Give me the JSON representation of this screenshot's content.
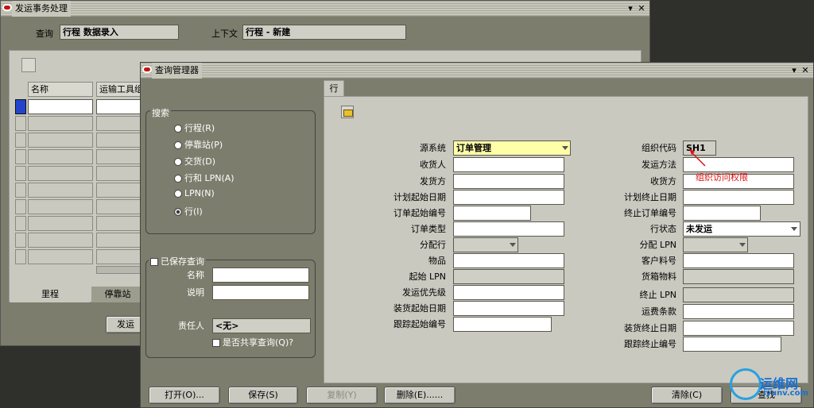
{
  "bg_window": {
    "title": "发运事务处理",
    "query_label": "查询",
    "query_value": "行程 数据录入",
    "context_label": "上下文",
    "context_value": "行程 - 新建",
    "col_name": "名称",
    "col_vehicle": "运输工具组",
    "tab_milestone": "里程",
    "tab_stop": "停靠站",
    "ship_button": "发运"
  },
  "query_manager": {
    "title": "查询管理器",
    "search": {
      "legend": "搜索",
      "options": [
        {
          "label": "行程(R)",
          "selected": false
        },
        {
          "label": "停靠站(P)",
          "selected": false
        },
        {
          "label": "交货(D)",
          "selected": false
        },
        {
          "label": "行和 LPN(A)",
          "selected": false
        },
        {
          "label": "LPN(N)",
          "selected": false
        },
        {
          "label": "行(I)",
          "selected": true
        }
      ]
    },
    "saved": {
      "legend": "已保存查询",
      "name_label": "名称",
      "desc_label": "说明",
      "owner_label": "责任人",
      "owner_value": "<无>",
      "shared_label": "是否共享查询(Q)?"
    },
    "tab_label": "行",
    "left_fields": [
      {
        "label": "源系统",
        "value": "订单管理"
      },
      {
        "label": "收货人",
        "value": ""
      },
      {
        "label": "发货方",
        "value": ""
      },
      {
        "label": "计划起始日期",
        "value": ""
      },
      {
        "label": "订单起始编号",
        "value": ""
      },
      {
        "label": "订单类型",
        "value": ""
      },
      {
        "label": "分配行",
        "value": ""
      },
      {
        "label": "物品",
        "value": ""
      },
      {
        "label": "起始 LPN",
        "value": ""
      },
      {
        "label": "发运优先级",
        "value": ""
      },
      {
        "label": "装货起始日期",
        "value": ""
      },
      {
        "label": "跟踪起始编号",
        "value": ""
      }
    ],
    "right_fields": [
      {
        "label": "组织代码",
        "value": "SH1"
      },
      {
        "label": "发运方法",
        "value": ""
      },
      {
        "label": "收货方",
        "value": ""
      },
      {
        "label": "计划终止日期",
        "value": ""
      },
      {
        "label": "终止订单编号",
        "value": ""
      },
      {
        "label": "行状态",
        "value": "未发运"
      },
      {
        "label": "分配 LPN",
        "value": ""
      },
      {
        "label": "客户料号",
        "value": ""
      },
      {
        "label": "货箱物料",
        "value": ""
      },
      {
        "label": "终止 LPN",
        "value": ""
      },
      {
        "label": "运费条款",
        "value": ""
      },
      {
        "label": "装货终止日期",
        "value": ""
      },
      {
        "label": "跟踪终止编号",
        "value": ""
      }
    ],
    "annotation": "组织访问权限",
    "buttons": {
      "open": "打开(O)...",
      "save": "保存(S)",
      "copy": "复制(Y)",
      "delete": "删除(E)......",
      "clear": "清除(C)",
      "find": "查找"
    }
  },
  "watermark": {
    "text": "运维网",
    "url": "iyunv.com"
  }
}
